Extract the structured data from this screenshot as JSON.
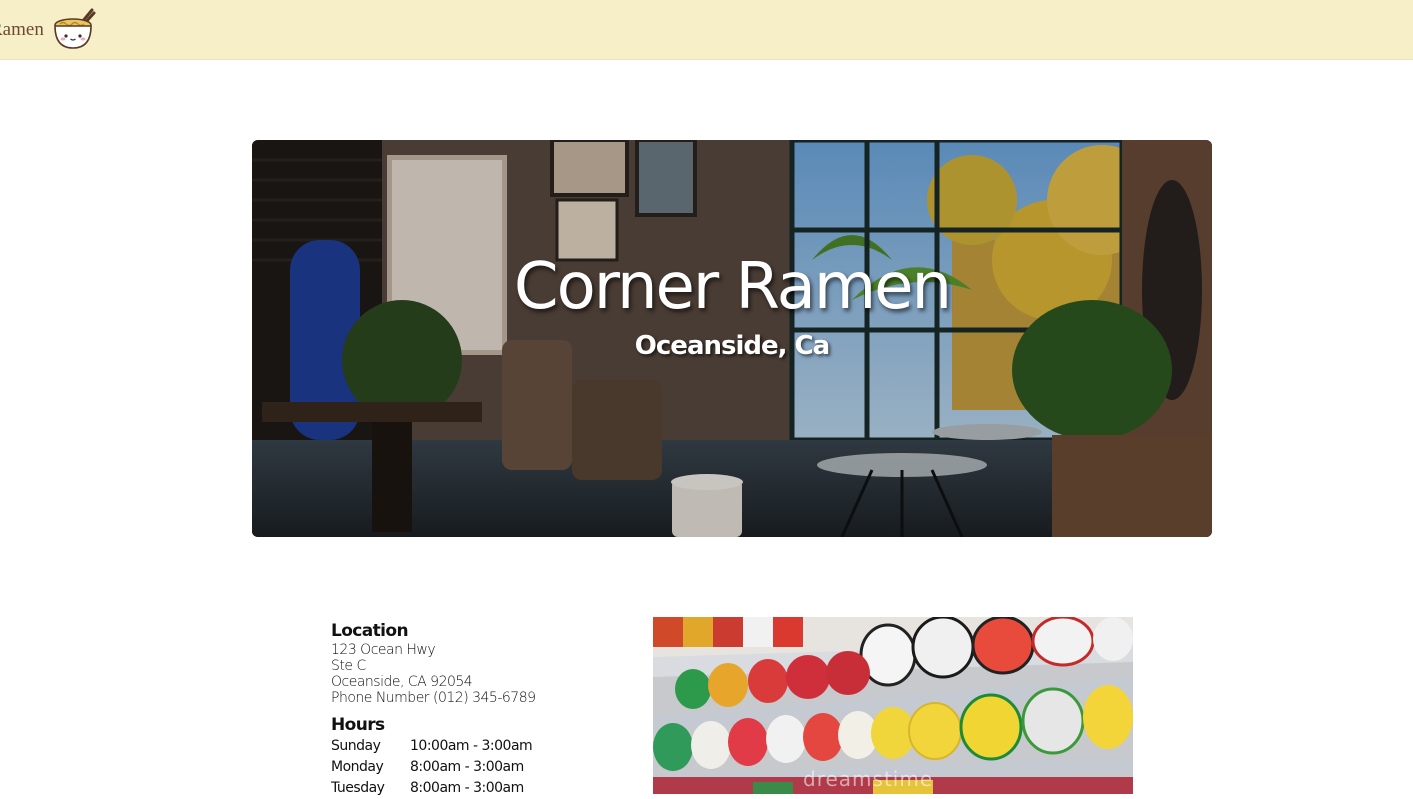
{
  "navbar": {
    "brand_text": "Ramen",
    "brand_icon": "ramen-bowl-icon"
  },
  "hero": {
    "title": "Corner Ramen",
    "subtitle": "Oceanside, Ca"
  },
  "location": {
    "heading": "Location",
    "lines": [
      "123 Ocean Hwy",
      "Ste C",
      "Oceanside, CA 92054",
      "Phone Number (012) 345-6789"
    ]
  },
  "hours": {
    "heading": "Hours",
    "rows": [
      {
        "day": "Sunday",
        "time": "10:00am - 3:00am"
      },
      {
        "day": "Monday",
        "time": "8:00am - 3:00am"
      },
      {
        "day": "Tuesday",
        "time": "8:00am - 3:00am"
      }
    ]
  },
  "shelf_image": {
    "watermark": "dreamstime"
  },
  "colors": {
    "navbar_bg": "#f7efc8",
    "brand_text": "#6b4a33"
  }
}
